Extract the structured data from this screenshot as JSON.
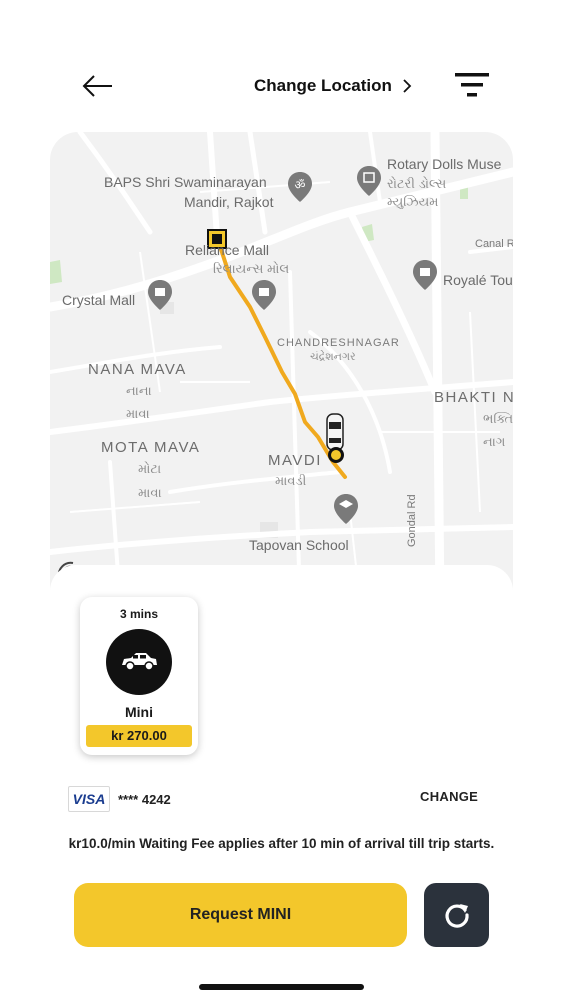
{
  "header": {
    "title": "Change Location",
    "back_icon": "arrow-left-icon",
    "filter_icon": "filter-icon"
  },
  "map": {
    "labels": {
      "rotary": "Rotary Dolls Muse",
      "rotary_guj1": "રોટરી ડોલ્સ",
      "rotary_guj2": "મ્યુઝિયમ",
      "baps1": "BAPS Shri Swaminarayan",
      "baps2": "Mandir, Rajkot",
      "reliance": "Reliance Mall",
      "reliance_guj": "રિલાયન્સ મોલ",
      "canal": "Canal R",
      "royale": "Royalé Tou",
      "crystal": "Crystal Mall",
      "chandresh": "CHANDRESHNAGAR",
      "chandresh_guj": "ચંદ્રેશનગર",
      "nana_mava": "NANA MAVA",
      "nana_guj1": "નાના",
      "nana_guj2": "માવા",
      "bhakti": "BHAKTI N",
      "bhakti_guj1": "ભક્તિ",
      "bhakti_guj2": "નાગ",
      "mota_mava": "MOTA MAVA",
      "mota_guj1": "મોટા",
      "mota_guj2": "માવા",
      "mavdi": "MAVDI",
      "mavdi_guj": "માવડી",
      "tapovan": "Tapovan School",
      "gondal": "Gondal Rd"
    }
  },
  "vehicle": {
    "eta": "3 mins",
    "name": "Mini",
    "price": "kr 270.00",
    "icon": "car-icon"
  },
  "payment": {
    "brand": "VISA",
    "card_masked": "**** 4242",
    "change_label": "CHANGE"
  },
  "fee_note": "kr10.0/min Waiting Fee applies after 10 min of arrival till trip starts.",
  "actions": {
    "request_label": "Request MINI",
    "refresh_icon": "refresh-icon"
  },
  "colors": {
    "accent": "#f3c72b",
    "dark_button": "#2b323c",
    "route": "#f0a91e"
  }
}
